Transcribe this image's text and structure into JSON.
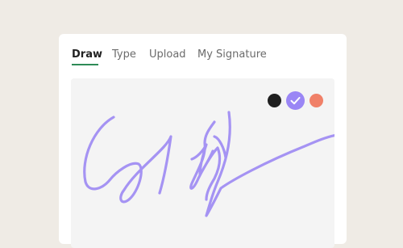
{
  "tabs": [
    {
      "label": "Draw",
      "active": true
    },
    {
      "label": "Type",
      "active": false
    },
    {
      "label": "Upload",
      "active": false
    },
    {
      "label": "My Signature",
      "active": false
    }
  ],
  "colors": {
    "background": "#efebe5",
    "accent_underline": "#2e8b57",
    "swatches": [
      "#1f1f1f",
      "#9a86f5",
      "#f08068"
    ],
    "selected_swatch": "#9a86f5",
    "ink": "#a593f3"
  },
  "icons": {
    "selected_indicator": "check-icon"
  }
}
